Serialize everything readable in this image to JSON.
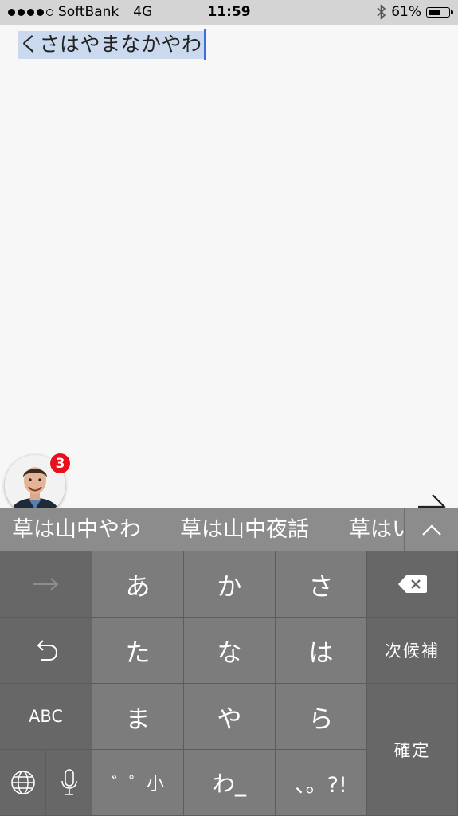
{
  "status_bar": {
    "carrier": "SoftBank",
    "network": "4G",
    "time": "11:59",
    "battery_percent": "61%",
    "battery_level": 0.61
  },
  "editor": {
    "composing_text": "くさはやまなかやわ"
  },
  "contact": {
    "badge_count": "3"
  },
  "candidates": {
    "items": [
      "草は山中やわ",
      "草は山中夜話",
      "草はい"
    ]
  },
  "keyboard": {
    "row1": [
      "あ",
      "か",
      "さ"
    ],
    "row2": [
      "た",
      "な",
      "は"
    ],
    "row3": [
      "ま",
      "や",
      "ら"
    ],
    "row4": [
      "゛゜小",
      "わ_",
      "、。?!"
    ],
    "abc_label": "ABC",
    "next_candidate_label": "次候補",
    "confirm_label": "確定"
  },
  "colors": {
    "status_bar_bg": "#d4d4d4",
    "selection_bg": "#cbd9ee",
    "caret": "#3a6fdc",
    "badge": "#e8101a",
    "key_light": "#7c7c7c",
    "key_dark": "#676767",
    "candidate_bar": "#8c8c8c"
  }
}
